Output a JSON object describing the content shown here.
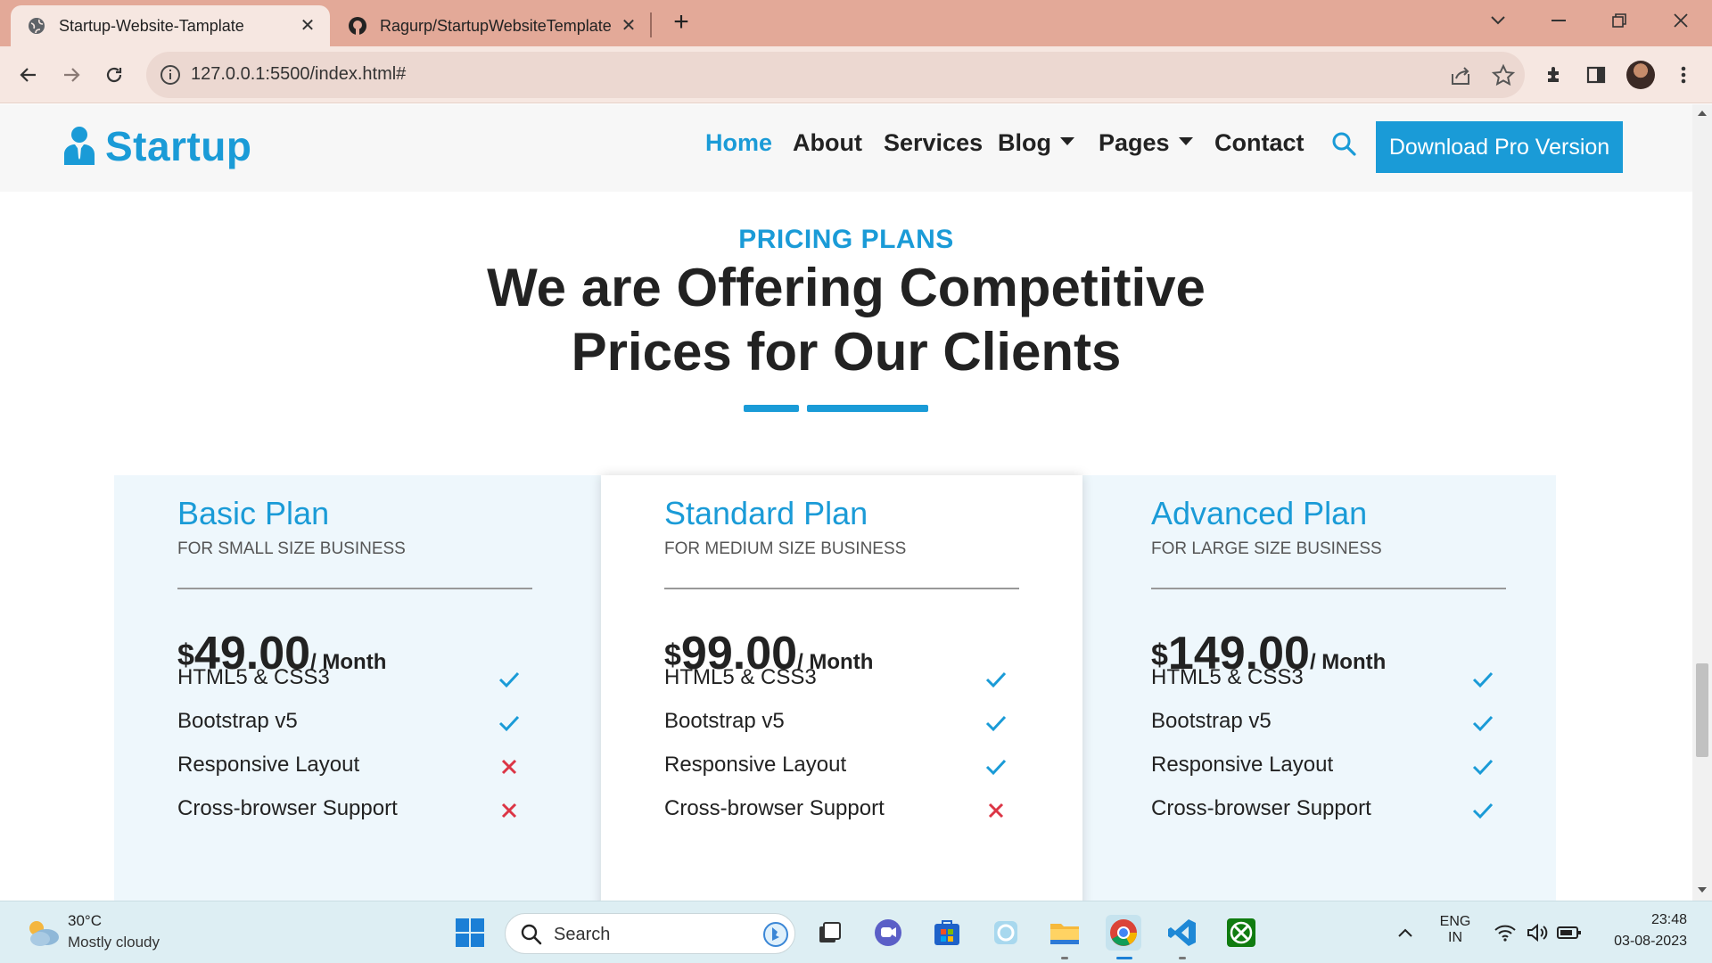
{
  "browser": {
    "tabs": [
      {
        "title": "Startup-Website-Tamplate",
        "active": true
      },
      {
        "title": "Ragurp/StartupWebsiteTemplate",
        "active": false
      }
    ],
    "url": "127.0.0.1:5500/index.html#"
  },
  "site": {
    "brand": "Startup",
    "nav": [
      "Home",
      "About",
      "Services",
      "Blog",
      "Pages",
      "Contact"
    ],
    "cta": "Download Pro Version",
    "accent": "#1a9bd7",
    "eyebrow": "PRICING PLANS",
    "headline_line1": "We are Offering Competitive",
    "headline_line2": "Prices for Our Clients",
    "plans": [
      {
        "name": "Basic Plan",
        "subtitle": "FOR SMALL SIZE BUSINESS",
        "currency": "$",
        "amount": "49.00",
        "period": "/ Month",
        "features": [
          {
            "label": "HTML5 & CSS3",
            "included": true
          },
          {
            "label": "Bootstrap v5",
            "included": true
          },
          {
            "label": "Responsive Layout",
            "included": false
          },
          {
            "label": "Cross-browser Support",
            "included": false
          }
        ]
      },
      {
        "name": "Standard Plan",
        "subtitle": "FOR MEDIUM SIZE BUSINESS",
        "currency": "$",
        "amount": "99.00",
        "period": "/ Month",
        "features": [
          {
            "label": "HTML5 & CSS3",
            "included": true
          },
          {
            "label": "Bootstrap v5",
            "included": true
          },
          {
            "label": "Responsive Layout",
            "included": true
          },
          {
            "label": "Cross-browser Support",
            "included": false
          }
        ]
      },
      {
        "name": "Advanced Plan",
        "subtitle": "FOR LARGE SIZE BUSINESS",
        "currency": "$",
        "amount": "149.00",
        "period": "/ Month",
        "features": [
          {
            "label": "HTML5 & CSS3",
            "included": true
          },
          {
            "label": "Bootstrap v5",
            "included": true
          },
          {
            "label": "Responsive Layout",
            "included": true
          },
          {
            "label": "Cross-browser Support",
            "included": true
          }
        ]
      }
    ]
  },
  "taskbar": {
    "weather_temp": "30°C",
    "weather_desc": "Mostly cloudy",
    "search_label": "Search",
    "lang_line1": "ENG",
    "lang_line2": "IN",
    "time": "23:48",
    "date": "03-08-2023"
  }
}
